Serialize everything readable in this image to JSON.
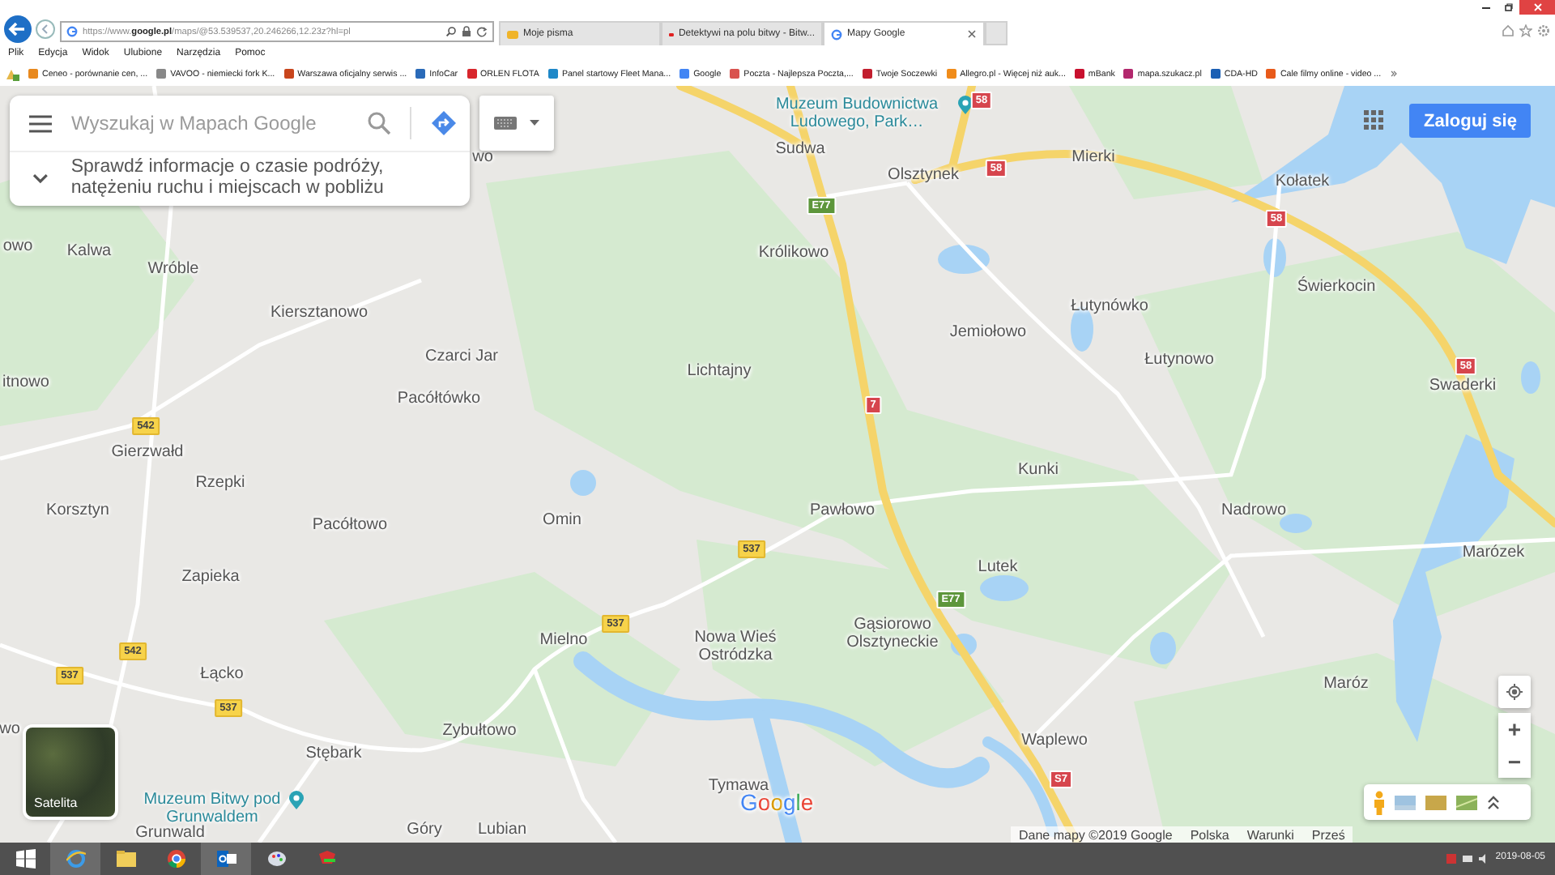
{
  "browser": {
    "address": "https://www.**google.pl**/maps/@53.539537,20.246266,12.23z?hl=pl",
    "tabs": [
      {
        "label": "Moje pisma",
        "selected": false
      },
      {
        "label": "Detektywi na polu bitwy - Bitw...",
        "selected": false
      },
      {
        "label": "Mapy Google",
        "selected": true
      }
    ],
    "menu": [
      "Plik",
      "Edycja",
      "Widok",
      "Ulubione",
      "Narzędzia",
      "Pomoc"
    ],
    "favorites": [
      "Ceneo - porównanie cen, ...",
      "VAVOO - niemiecki fork K...",
      "Warszawa oficjalny serwis ...",
      "InfoCar",
      "ORLEN FLOTA",
      "Panel startowy Fleet Mana...",
      "Google",
      "Poczta - Najlepsza Poczta,...",
      "Twoje Soczewki",
      "Allegro.pl - Więcej niż auk...",
      "mBank",
      "mapa.szukacz.pl",
      "CDA-HD",
      "Cale filmy online - video ..."
    ]
  },
  "map": {
    "search": {
      "placeholder": "Wyszukaj w Mapach Google"
    },
    "hint": "Sprawdź informacje o czasie podróży, natężeniu ruchu i miejscach w pobliżu",
    "sign_in": "Zaloguj się",
    "places": [
      {
        "name": "Muzeum Budownictwa Ludowego, Park…",
        "kind": "poi"
      },
      {
        "name": "Sudwa",
        "kind": "town"
      },
      {
        "name": "Olsztynek",
        "kind": "town"
      },
      {
        "name": "Mierki",
        "kind": "town"
      },
      {
        "name": "wo",
        "kind": "town"
      },
      {
        "name": "Kołatek",
        "kind": "town"
      },
      {
        "name": "owo",
        "kind": "town"
      },
      {
        "name": "Kalwa",
        "kind": "town"
      },
      {
        "name": "Królikowo",
        "kind": "town"
      },
      {
        "name": "Wróble",
        "kind": "town"
      },
      {
        "name": "Świerkocin",
        "kind": "town"
      },
      {
        "name": "Łutynówko",
        "kind": "town"
      },
      {
        "name": "Kiersztanowo",
        "kind": "town"
      },
      {
        "name": "Jemiołowo",
        "kind": "town"
      },
      {
        "name": "Czarci Jar",
        "kind": "town"
      },
      {
        "name": "Łutynowo",
        "kind": "town"
      },
      {
        "name": "Lichtajny",
        "kind": "town"
      },
      {
        "name": "itnowo",
        "kind": "town"
      },
      {
        "name": "Swaderki",
        "kind": "town"
      },
      {
        "name": "Pacółtówko",
        "kind": "town"
      },
      {
        "name": "Gierzwałd",
        "kind": "town"
      },
      {
        "name": "Kunki",
        "kind": "town"
      },
      {
        "name": "Rzepki",
        "kind": "town"
      },
      {
        "name": "Korsztyn",
        "kind": "town"
      },
      {
        "name": "Pawłowo",
        "kind": "town"
      },
      {
        "name": "Nadrowo",
        "kind": "town"
      },
      {
        "name": "Pacółtowo",
        "kind": "town"
      },
      {
        "name": "Omin",
        "kind": "town"
      },
      {
        "name": "Marózek",
        "kind": "town"
      },
      {
        "name": "Lutek",
        "kind": "town"
      },
      {
        "name": "Zapieka",
        "kind": "town"
      },
      {
        "name": "Mielno",
        "kind": "town"
      },
      {
        "name": "Nowa Wieś Ostródzka",
        "kind": "town"
      },
      {
        "name": "Gąsiorowo Olsztyneckie",
        "kind": "town"
      },
      {
        "name": "Łącko",
        "kind": "town"
      },
      {
        "name": "Maróz",
        "kind": "town"
      },
      {
        "name": "wo",
        "kind": "town"
      },
      {
        "name": "Zybułtowo",
        "kind": "town"
      },
      {
        "name": "Waplewo",
        "kind": "town"
      },
      {
        "name": "Stębark",
        "kind": "town"
      },
      {
        "name": "Tymawa",
        "kind": "town"
      },
      {
        "name": "Muzeum Bitwy pod Grunwaldem",
        "kind": "poi"
      },
      {
        "name": "Grunwald",
        "kind": "town"
      },
      {
        "name": "Góry",
        "kind": "town"
      },
      {
        "name": "Lubian",
        "kind": "town"
      }
    ],
    "roads": [
      {
        "number": "58",
        "kind": "national"
      },
      {
        "number": "58",
        "kind": "national"
      },
      {
        "number": "E77",
        "kind": "european"
      },
      {
        "number": "58",
        "kind": "national"
      },
      {
        "number": "58",
        "kind": "national"
      },
      {
        "number": "7",
        "kind": "national"
      },
      {
        "number": "542",
        "kind": "regional"
      },
      {
        "number": "537",
        "kind": "regional"
      },
      {
        "number": "E77",
        "kind": "european"
      },
      {
        "number": "537",
        "kind": "regional"
      },
      {
        "number": "542",
        "kind": "regional"
      },
      {
        "number": "537",
        "kind": "regional"
      },
      {
        "number": "537",
        "kind": "regional"
      },
      {
        "number": "S7",
        "kind": "national"
      }
    ],
    "satellite": "Satelita",
    "logo": "Google",
    "zoom_in": "+",
    "zoom_out": "−",
    "footer": [
      "Dane mapy ©2019 Google",
      "Polska",
      "Warunki",
      "Prześ"
    ]
  },
  "taskbar": {
    "date": "2019-08-05"
  }
}
